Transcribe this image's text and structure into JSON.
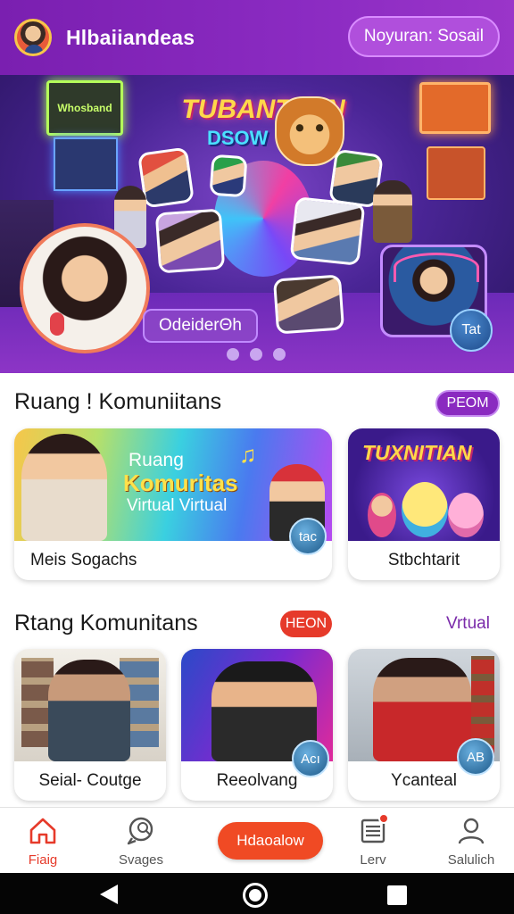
{
  "header": {
    "app_title": "Hlbaiiandeas",
    "action_button": "Noyuran: Sosail"
  },
  "banner": {
    "title_line1": "TUBANTIAIN",
    "title_line2": "DSOW",
    "sign_text": "Whosband",
    "pill_label": "OdeiderΘh",
    "bubble_label": "Tat",
    "page_dots": 3
  },
  "section1": {
    "title": "Ruang ! Komuniitans",
    "pill": "PEOM",
    "cards": [
      {
        "label": "Meis Sogachs",
        "image_text_1": "Ruang",
        "image_text_2": "Komuritas",
        "image_text_3": "Virtual Virtual",
        "badge": "tac"
      },
      {
        "label": "Stbchtarit",
        "image_title": "TUXNITIAN"
      }
    ]
  },
  "section2": {
    "title": "Rtang Komunitans",
    "pill": "HEON",
    "link": "Vrtual",
    "cards": [
      {
        "label": "Seial- Coutge"
      },
      {
        "label": "Reeolvang",
        "badge": "Acı"
      },
      {
        "label": "Ycanteal",
        "badge": "AB"
      }
    ]
  },
  "bottom_nav": {
    "items": [
      {
        "label": "Fiaig",
        "icon": "home-icon",
        "active": true
      },
      {
        "label": "Svages",
        "icon": "chat-search-icon"
      },
      {
        "label": "Lerv",
        "icon": "list-icon",
        "notification": true
      },
      {
        "label": "Salulich",
        "icon": "person-icon"
      }
    ],
    "cta_label": "Hdaoalow"
  },
  "colors": {
    "header_purple": "#8b2bc2",
    "accent_orange": "#f04a24",
    "active_red": "#e63a2a",
    "link_purple": "#7a2aaa"
  }
}
